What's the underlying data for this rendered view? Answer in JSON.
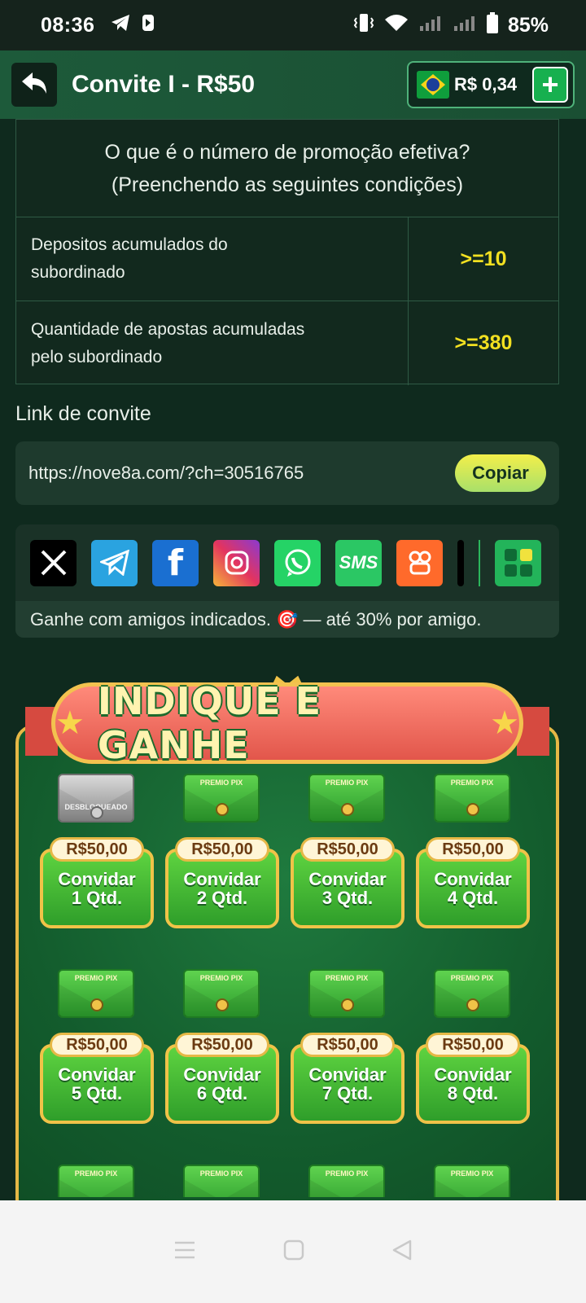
{
  "status_bar": {
    "time": "08:36",
    "battery": "85%"
  },
  "header": {
    "title": "Convite I - R$50",
    "balance": "R$ 0,34"
  },
  "conditions": {
    "heading_line1": "O que é o número de promoção efetiva?",
    "heading_line2": "(Preenchendo as seguintes condições)",
    "rows": [
      {
        "label_line1": "Depositos acumulados do",
        "label_line2": "subordinado",
        "value": ">=10"
      },
      {
        "label_line1": "Quantidade de apostas acumuladas",
        "label_line2": "pelo subordinado",
        "value": ">=380"
      }
    ]
  },
  "invite_link": {
    "label": "Link de convite",
    "url": "https://nove8a.com/?ch=30516765",
    "copy_label": "Copiar"
  },
  "share": {
    "icons": [
      "x-icon",
      "telegram-icon",
      "facebook-icon",
      "instagram-icon",
      "whatsapp-icon",
      "sms-icon",
      "kwai-icon",
      "tiktok-icon",
      "more-apps-icon"
    ],
    "sms_label": "SMS",
    "note": "Ganhe com amigos indicados. 🎯 — até 30% por amigo."
  },
  "promo": {
    "banner": "INDIQUE E GANHE",
    "envelope_label": "PREMIO PIX",
    "locked_label": "DESBLOQUEADO",
    "rewards": [
      {
        "amount": "R$50,00",
        "action": "Convidar",
        "qty": "1 Qtd.",
        "locked": true
      },
      {
        "amount": "R$50,00",
        "action": "Convidar",
        "qty": "2 Qtd.",
        "locked": false
      },
      {
        "amount": "R$50,00",
        "action": "Convidar",
        "qty": "3 Qtd.",
        "locked": false
      },
      {
        "amount": "R$50,00",
        "action": "Convidar",
        "qty": "4 Qtd.",
        "locked": false
      },
      {
        "amount": "R$50,00",
        "action": "Convidar",
        "qty": "5 Qtd.",
        "locked": false
      },
      {
        "amount": "R$50,00",
        "action": "Convidar",
        "qty": "6 Qtd.",
        "locked": false
      },
      {
        "amount": "R$50,00",
        "action": "Convidar",
        "qty": "7 Qtd.",
        "locked": false
      },
      {
        "amount": "R$50,00",
        "action": "Convidar",
        "qty": "8 Qtd.",
        "locked": false
      }
    ]
  },
  "colors": {
    "accent_yellow": "#f2e021",
    "brand_green": "#17b04f",
    "bg_dark": "#0f2a1e"
  }
}
